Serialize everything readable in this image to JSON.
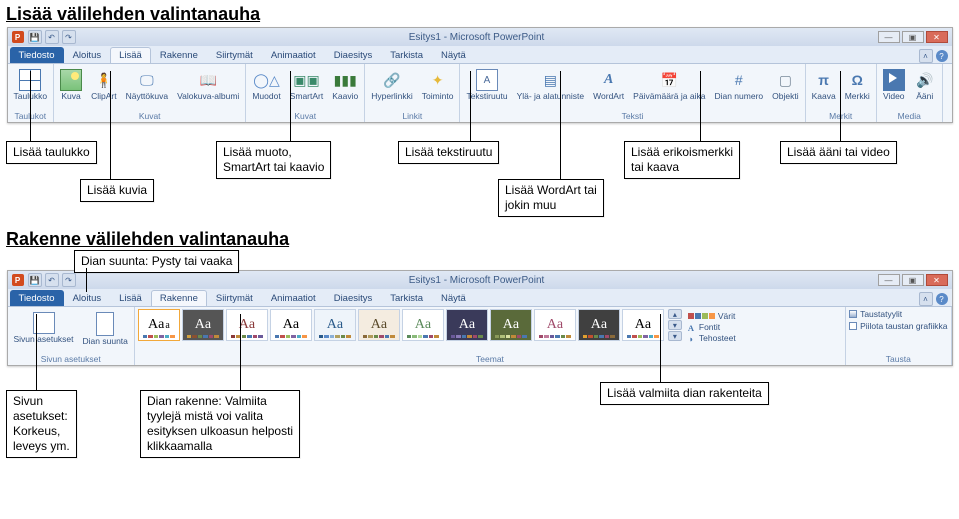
{
  "section1": {
    "title": "Lisää välilehden valintanauha",
    "callouts": {
      "table": "Lisää taulukko",
      "images": "Lisää kuvia",
      "shapes": "Lisää muoto,\nSmartArt tai kaavio",
      "textbox": "Lisää tekstiruutu",
      "wordart": "Lisää WordArt tai\njokin muu",
      "symbol": "Lisää erikoismerkki\ntai kaava",
      "media": "Lisää ääni tai video"
    }
  },
  "ribbon_insert": {
    "app": "P",
    "window_title": "Esitys1 - Microsoft PowerPoint",
    "file_tab": "Tiedosto",
    "tabs": [
      "Aloitus",
      "Lisää",
      "Rakenne",
      "Siirtymät",
      "Animaatiot",
      "Diaesitys",
      "Tarkista",
      "Näytä"
    ],
    "active_tab": "Lisää",
    "groups": {
      "tables": {
        "label": "Taulukot",
        "items": [
          "Taulukko"
        ]
      },
      "images": {
        "label": "Kuvat",
        "items": [
          "Kuva",
          "ClipArt",
          "Näyttökuva",
          "Valokuva-albumi"
        ]
      },
      "illustrations": {
        "label": "Kuvat",
        "items": [
          "Muodot",
          "SmartArt",
          "Kaavio"
        ]
      },
      "links": {
        "label": "Linkit",
        "items": [
          "Hyperlinkki",
          "Toiminto"
        ]
      },
      "text": {
        "label": "Teksti",
        "items": [
          "Tekstiruutu",
          "Ylä- ja alatunniste",
          "WordArt",
          "Päivämäärä ja aika",
          "Dian numero",
          "Objekti"
        ]
      },
      "symbols": {
        "label": "Merkit",
        "items": [
          "Kaava",
          "Merkki"
        ]
      },
      "media": {
        "label": "Media",
        "items": [
          "Video",
          "Ääni"
        ]
      }
    }
  },
  "section2": {
    "title": "Rakenne välilehden valintanauha",
    "callouts": {
      "orientation": "Dian suunta: Pysty tai vaaka",
      "pagesetup": "Sivun\nasetukset:\nKorkeus,\nleveys ym.",
      "themes": "Dian rakenne: Valmiita\ntyylejä mistä voi valita\nesityksen ulkoasun helposti\nklikkaamalla",
      "moretheme": "Lisää valmiita dian rakenteita"
    }
  },
  "ribbon_design": {
    "window_title": "Esitys1 - Microsoft PowerPoint",
    "file_tab": "Tiedosto",
    "tabs": [
      "Aloitus",
      "Lisää",
      "Rakenne",
      "Siirtymät",
      "Animaatiot",
      "Diaesitys",
      "Tarkista",
      "Näytä"
    ],
    "active_tab": "Rakenne",
    "groups": {
      "pagesetup": {
        "label": "Sivun asetukset",
        "items": [
          "Sivun asetukset",
          "Dian suunta"
        ]
      },
      "themes": {
        "label": "Teemat",
        "aa": "Aa"
      },
      "side": {
        "colors": "Värit",
        "fonts": "Fontit",
        "effects": "Tehosteet"
      },
      "background": {
        "label": "Tausta",
        "items": [
          "Taustatyylit",
          "Piilota taustan grafiikka"
        ]
      }
    }
  }
}
